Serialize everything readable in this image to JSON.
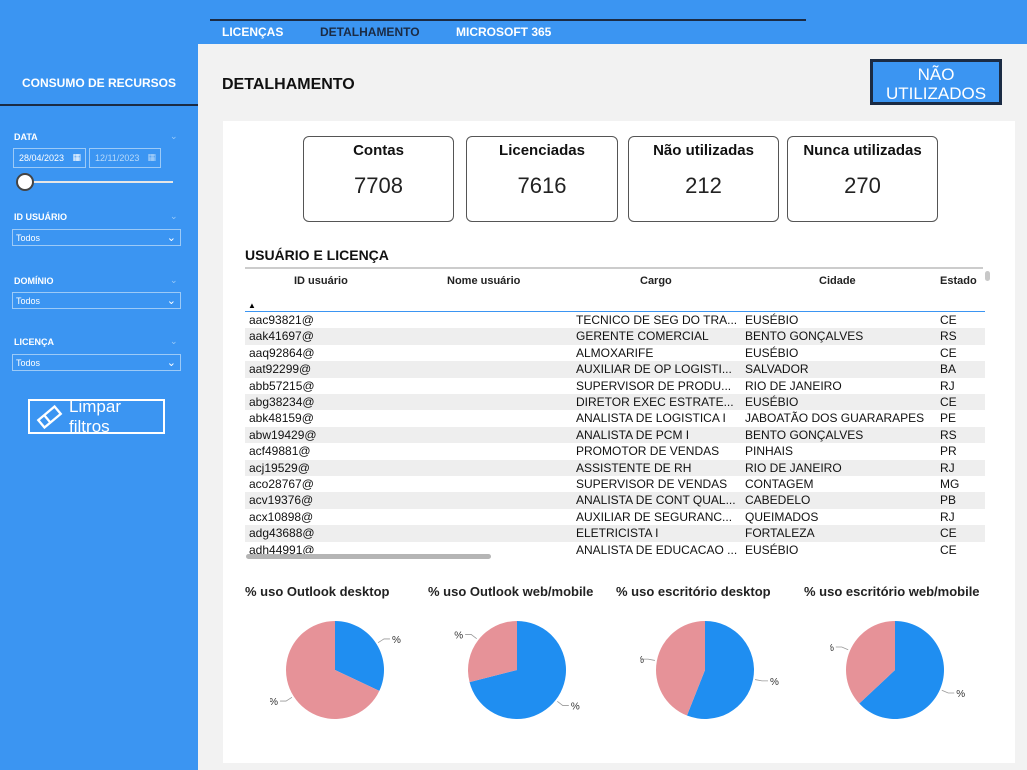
{
  "sidebar": {
    "title": "CONSUMO DE RECURSOS",
    "date_label": "DATA",
    "date_start": "28/04/2023",
    "date_end": "12/11/2023",
    "user_label": "ID USUÁRIO",
    "user_value": "Todos",
    "domain_label": "DOMÍNIO",
    "domain_value": "Todos",
    "license_label": "LICENÇA",
    "license_value": "Todos",
    "clear_label": "Limpar filtros"
  },
  "nav": {
    "tabs": [
      "LICENÇAS",
      "DETALHAMENTO",
      "MICROSOFT 365"
    ]
  },
  "page_title": "DETALHAMENTO",
  "unused_button": "NÃO UTILIZADOS",
  "kpis": [
    {
      "label": "Contas",
      "value": "7708"
    },
    {
      "label": "Licenciadas",
      "value": "7616"
    },
    {
      "label": "Não utilizadas",
      "value": "212"
    },
    {
      "label": "Nunca utilizadas",
      "value": "270"
    }
  ],
  "table": {
    "title": "USUÁRIO E LICENÇA",
    "columns": [
      "ID usuário",
      "Nome usuário",
      "Cargo",
      "Cidade",
      "Estado"
    ],
    "rows": [
      [
        "aac93821@",
        "",
        "TECNICO DE SEG DO TRA...",
        "EUSÉBIO",
        "CE"
      ],
      [
        "aak41697@",
        "",
        "GERENTE COMERCIAL",
        "BENTO GONÇALVES",
        "RS"
      ],
      [
        "aaq92864@",
        "",
        "ALMOXARIFE",
        "EUSÉBIO",
        "CE"
      ],
      [
        "aat92299@",
        "",
        "AUXILIAR DE OP LOGISTI...",
        "SALVADOR",
        "BA"
      ],
      [
        "abb57215@",
        "",
        "SUPERVISOR DE PRODU...",
        "RIO DE JANEIRO",
        "RJ"
      ],
      [
        "abg38234@",
        "",
        "DIRETOR EXEC ESTRATE...",
        "EUSÉBIO",
        "CE"
      ],
      [
        "abk48159@",
        "",
        "ANALISTA DE LOGISTICA I",
        "JABOATÃO DOS GUARARAPES",
        "PE"
      ],
      [
        "abw19429@",
        "",
        "ANALISTA DE PCM I",
        "BENTO GONÇALVES",
        "RS"
      ],
      [
        "acf49881@",
        "",
        "PROMOTOR DE VENDAS",
        "PINHAIS",
        "PR"
      ],
      [
        "acj19529@",
        "",
        "ASSISTENTE DE RH",
        "RIO DE JANEIRO",
        "RJ"
      ],
      [
        "aco28767@",
        "",
        "SUPERVISOR DE VENDAS",
        "CONTAGEM",
        "MG"
      ],
      [
        "acv19376@",
        "",
        "ANALISTA DE CONT QUAL...",
        "CABEDELO",
        "PB"
      ],
      [
        "acx10898@",
        "",
        "AUXILIAR DE SEGURANC...",
        "QUEIMADOS",
        "RJ"
      ],
      [
        "adg43688@",
        "",
        "ELETRICISTA I",
        "FORTALEZA",
        "CE"
      ],
      [
        "adh44991@",
        "",
        "ANALISTA DE EDUCACAO ...",
        "EUSÉBIO",
        "CE"
      ]
    ]
  },
  "chart_data": [
    {
      "type": "pie",
      "title": "% uso Outlook desktop",
      "label": "%",
      "values": [
        0.32,
        0.68
      ],
      "colors": [
        "#1f8ef1",
        "#e69298"
      ]
    },
    {
      "type": "pie",
      "title": "% uso Outlook web/mobile",
      "label": "%",
      "values": [
        0.71,
        0.29
      ],
      "colors": [
        "#1f8ef1",
        "#e69298"
      ]
    },
    {
      "type": "pie",
      "title": "% uso escritório desktop",
      "label": "%",
      "values": [
        0.56,
        0.44
      ],
      "colors": [
        "#1f8ef1",
        "#e69298"
      ]
    },
    {
      "type": "pie",
      "title": "% uso escritório web/mobile",
      "label": "%",
      "values": [
        0.63,
        0.37
      ],
      "colors": [
        "#1f8ef1",
        "#e69298"
      ]
    }
  ]
}
